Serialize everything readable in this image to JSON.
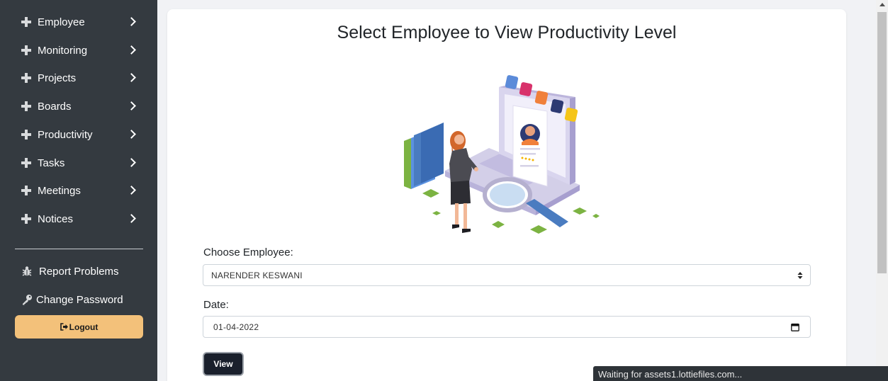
{
  "sidebar": {
    "nav_items": [
      {
        "label": "Employee"
      },
      {
        "label": "Monitoring"
      },
      {
        "label": "Projects"
      },
      {
        "label": "Boards"
      },
      {
        "label": "Productivity"
      },
      {
        "label": "Tasks"
      },
      {
        "label": "Meetings"
      },
      {
        "label": "Notices"
      }
    ],
    "report_problems": "Report Problems",
    "change_password": "Change Password",
    "logout": "Logout"
  },
  "main": {
    "title": "Select Employee to View Productivity Level",
    "employee_label": "Choose Employee:",
    "employee_selected": "NARENDER KESWANI",
    "date_label": "Date:",
    "date_value": "01-04-2022",
    "view_button": "View"
  },
  "status_bar": {
    "text": "Waiting for assets1.lottiefiles.com..."
  },
  "colors": {
    "sidebar_bg": "#343a40",
    "logout_bg": "#f3c17a",
    "view_bg": "#1a202c",
    "accent_green": "#7cb342"
  },
  "icons": {
    "nav_expand": "plus-icon",
    "nav_arrow": "chevron-right-icon",
    "report": "bug-icon",
    "password": "key-icon",
    "logout": "sign-out-icon",
    "select": "sort-arrows-icon",
    "date": "calendar-icon"
  }
}
